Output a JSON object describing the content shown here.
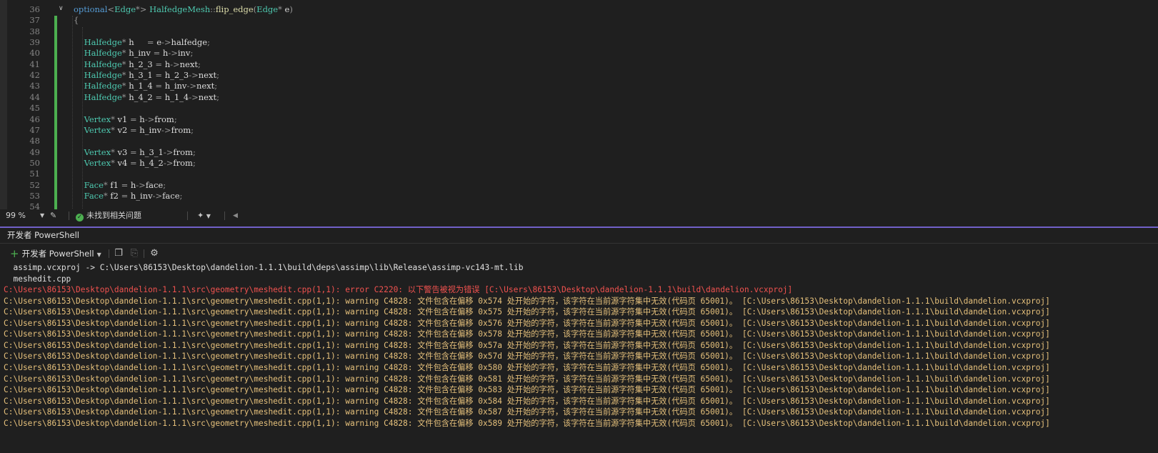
{
  "editor": {
    "lines": [
      {
        "num": "36",
        "code": "optional<Edge*> HalfedgeMesh::flip_edge(Edge* e)"
      },
      {
        "num": "37",
        "code": "{"
      },
      {
        "num": "38",
        "code": ""
      },
      {
        "num": "39",
        "code": "    Halfedge* h     = e->halfedge;"
      },
      {
        "num": "40",
        "code": "    Halfedge* h_inv = h->inv;"
      },
      {
        "num": "41",
        "code": "    Halfedge* h_2_3 = h->next;"
      },
      {
        "num": "42",
        "code": "    Halfedge* h_3_1 = h_2_3->next;"
      },
      {
        "num": "43",
        "code": "    Halfedge* h_1_4 = h_inv->next;"
      },
      {
        "num": "44",
        "code": "    Halfedge* h_4_2 = h_1_4->next;"
      },
      {
        "num": "45",
        "code": ""
      },
      {
        "num": "46",
        "code": "    Vertex* v1 = h->from;"
      },
      {
        "num": "47",
        "code": "    Vertex* v2 = h_inv->from;"
      },
      {
        "num": "48",
        "code": ""
      },
      {
        "num": "49",
        "code": "    Vertex* v3 = h_3_1->from;"
      },
      {
        "num": "50",
        "code": "    Vertex* v4 = h_4_2->from;"
      },
      {
        "num": "51",
        "code": ""
      },
      {
        "num": "52",
        "code": "    Face* f1 = h->face;"
      },
      {
        "num": "53",
        "code": "    Face* f2 = h_inv->face;"
      },
      {
        "num": "54",
        "code": ""
      }
    ]
  },
  "status": {
    "zoom": "99 %",
    "issues": "未找到相关问题"
  },
  "panel": {
    "title": "开发者 PowerShell",
    "new_label": "开发者 PowerShell"
  },
  "terminal": {
    "lines": [
      {
        "kind": "plain",
        "text": "  assimp.vcxproj -> C:\\Users\\86153\\Desktop\\dandelion-1.1.1\\build\\deps\\assimp\\lib\\Release\\assimp-vc143-mt.lib"
      },
      {
        "kind": "plain",
        "text": "  meshedit.cpp"
      },
      {
        "kind": "error",
        "text": "C:\\Users\\86153\\Desktop\\dandelion-1.1.1\\src\\geometry\\meshedit.cpp(1,1): error C2220: 以下警告被视为错误 [C:\\Users\\86153\\Desktop\\dandelion-1.1.1\\build\\dandelion.vcxproj]"
      },
      {
        "kind": "warn",
        "text": "C:\\Users\\86153\\Desktop\\dandelion-1.1.1\\src\\geometry\\meshedit.cpp(1,1): warning C4828: 文件包含在偏移 0x574 处开始的字符，该字符在当前源字符集中无效(代码页 65001)。 [C:\\Users\\86153\\Desktop\\dandelion-1.1.1\\build\\dandelion.vcxproj]"
      },
      {
        "kind": "warn",
        "text": "C:\\Users\\86153\\Desktop\\dandelion-1.1.1\\src\\geometry\\meshedit.cpp(1,1): warning C4828: 文件包含在偏移 0x575 处开始的字符，该字符在当前源字符集中无效(代码页 65001)。 [C:\\Users\\86153\\Desktop\\dandelion-1.1.1\\build\\dandelion.vcxproj]"
      },
      {
        "kind": "warn",
        "text": "C:\\Users\\86153\\Desktop\\dandelion-1.1.1\\src\\geometry\\meshedit.cpp(1,1): warning C4828: 文件包含在偏移 0x576 处开始的字符，该字符在当前源字符集中无效(代码页 65001)。 [C:\\Users\\86153\\Desktop\\dandelion-1.1.1\\build\\dandelion.vcxproj]"
      },
      {
        "kind": "warn",
        "text": "C:\\Users\\86153\\Desktop\\dandelion-1.1.1\\src\\geometry\\meshedit.cpp(1,1): warning C4828: 文件包含在偏移 0x578 处开始的字符，该字符在当前源字符集中无效(代码页 65001)。 [C:\\Users\\86153\\Desktop\\dandelion-1.1.1\\build\\dandelion.vcxproj]"
      },
      {
        "kind": "warn",
        "text": "C:\\Users\\86153\\Desktop\\dandelion-1.1.1\\src\\geometry\\meshedit.cpp(1,1): warning C4828: 文件包含在偏移 0x57a 处开始的字符，该字符在当前源字符集中无效(代码页 65001)。 [C:\\Users\\86153\\Desktop\\dandelion-1.1.1\\build\\dandelion.vcxproj]"
      },
      {
        "kind": "warn",
        "text": "C:\\Users\\86153\\Desktop\\dandelion-1.1.1\\src\\geometry\\meshedit.cpp(1,1): warning C4828: 文件包含在偏移 0x57d 处开始的字符，该字符在当前源字符集中无效(代码页 65001)。 [C:\\Users\\86153\\Desktop\\dandelion-1.1.1\\build\\dandelion.vcxproj]"
      },
      {
        "kind": "warn",
        "text": "C:\\Users\\86153\\Desktop\\dandelion-1.1.1\\src\\geometry\\meshedit.cpp(1,1): warning C4828: 文件包含在偏移 0x580 处开始的字符，该字符在当前源字符集中无效(代码页 65001)。 [C:\\Users\\86153\\Desktop\\dandelion-1.1.1\\build\\dandelion.vcxproj]"
      },
      {
        "kind": "warn",
        "text": "C:\\Users\\86153\\Desktop\\dandelion-1.1.1\\src\\geometry\\meshedit.cpp(1,1): warning C4828: 文件包含在偏移 0x581 处开始的字符，该字符在当前源字符集中无效(代码页 65001)。 [C:\\Users\\86153\\Desktop\\dandelion-1.1.1\\build\\dandelion.vcxproj]"
      },
      {
        "kind": "warn",
        "text": "C:\\Users\\86153\\Desktop\\dandelion-1.1.1\\src\\geometry\\meshedit.cpp(1,1): warning C4828: 文件包含在偏移 0x583 处开始的字符，该字符在当前源字符集中无效(代码页 65001)。 [C:\\Users\\86153\\Desktop\\dandelion-1.1.1\\build\\dandelion.vcxproj]"
      },
      {
        "kind": "warn",
        "text": "C:\\Users\\86153\\Desktop\\dandelion-1.1.1\\src\\geometry\\meshedit.cpp(1,1): warning C4828: 文件包含在偏移 0x584 处开始的字符，该字符在当前源字符集中无效(代码页 65001)。 [C:\\Users\\86153\\Desktop\\dandelion-1.1.1\\build\\dandelion.vcxproj]"
      },
      {
        "kind": "warn",
        "text": "C:\\Users\\86153\\Desktop\\dandelion-1.1.1\\src\\geometry\\meshedit.cpp(1,1): warning C4828: 文件包含在偏移 0x587 处开始的字符，该字符在当前源字符集中无效(代码页 65001)。 [C:\\Users\\86153\\Desktop\\dandelion-1.1.1\\build\\dandelion.vcxproj]"
      },
      {
        "kind": "warn",
        "text": "C:\\Users\\86153\\Desktop\\dandelion-1.1.1\\src\\geometry\\meshedit.cpp(1,1): warning C4828: 文件包含在偏移 0x589 处开始的字符，该字符在当前源字符集中无效(代码页 65001)。 [C:\\Users\\86153\\Desktop\\dandelion-1.1.1\\build\\dandelion.vcxproj]"
      }
    ]
  },
  "colors": {
    "accent": "#7160c8",
    "error": "#f0524f",
    "warning": "#e5c07b",
    "success": "#4caf50"
  },
  "icons": [
    "chevron-down-icon",
    "paint-icon",
    "check-circle-icon",
    "brush-icon",
    "plus-icon",
    "copy-icon",
    "paste-icon",
    "gear-icon"
  ]
}
